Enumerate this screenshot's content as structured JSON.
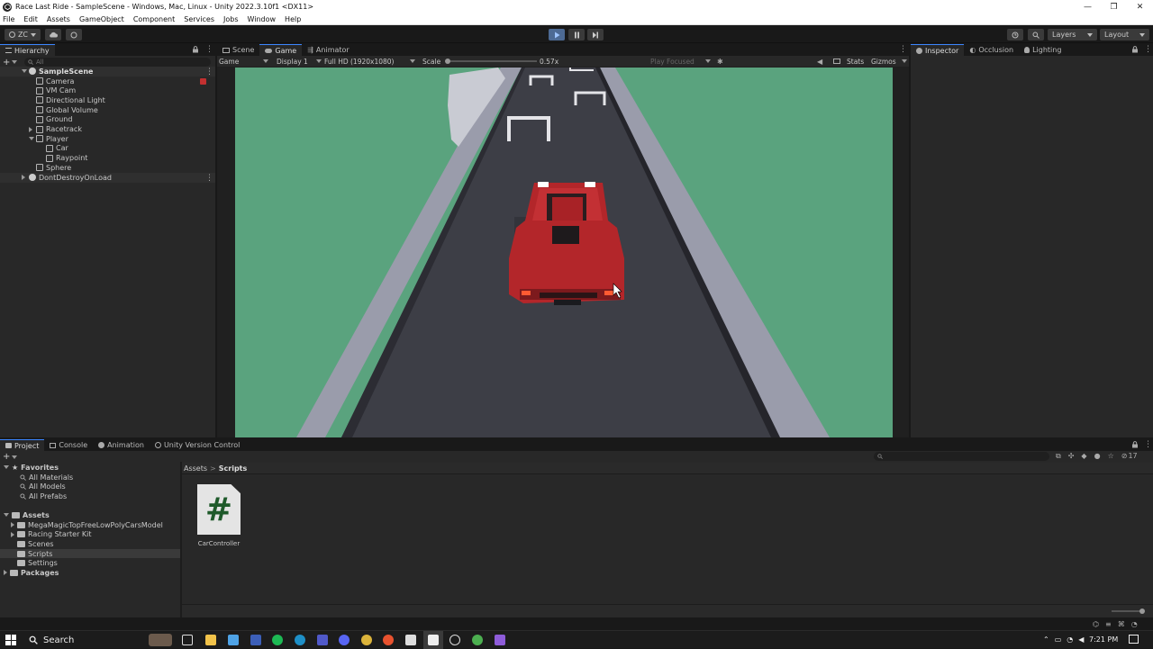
{
  "titlebar": {
    "title": "Race Last Ride - SampleScene - Windows, Mac, Linux - Unity 2022.3.10f1 <DX11>",
    "minimize": "—",
    "restore": "❐",
    "close": "✕"
  },
  "menu": [
    "File",
    "Edit",
    "Assets",
    "GameObject",
    "Component",
    "Services",
    "Jobs",
    "Window",
    "Help"
  ],
  "toolbar": {
    "account": "ZC",
    "layers": "Layers",
    "layout": "Layout"
  },
  "hierarchy": {
    "tab": "Hierarchy",
    "search_placeholder": "All",
    "scene": "SampleScene",
    "items": [
      {
        "label": "Camera",
        "indent": 1
      },
      {
        "label": "VM Cam",
        "indent": 1
      },
      {
        "label": "Directional Light",
        "indent": 1
      },
      {
        "label": "Global Volume",
        "indent": 1
      },
      {
        "label": "Ground",
        "indent": 1
      },
      {
        "label": "Racetrack",
        "indent": 1
      },
      {
        "label": "Player",
        "indent": 1
      },
      {
        "label": "Car",
        "indent": 2
      },
      {
        "label": "Raypoint",
        "indent": 2
      },
      {
        "label": "Sphere",
        "indent": 1
      }
    ],
    "dont_destroy": "DontDestroyOnLoad"
  },
  "center_tabs": [
    "Scene",
    "Game",
    "Animator"
  ],
  "game_toolbar": {
    "view": "Game",
    "display": "Display 1",
    "resolution": "Full HD (1920x1080)",
    "scale_label": "Scale",
    "scale_value": "0.57x",
    "play_focused": "Play Focused",
    "stats": "Stats",
    "gizmos": "Gizmos"
  },
  "right_tabs": [
    "Inspector",
    "Occlusion",
    "Lighting"
  ],
  "bottom_tabs": [
    "Project",
    "Console",
    "Animation",
    "Unity Version Control"
  ],
  "project": {
    "favorites_label": "Favorites",
    "favorites": [
      "All Materials",
      "All Models",
      "All Prefabs"
    ],
    "assets_label": "Assets",
    "assets": [
      "MegaMagicTopFreeLowPolyCarsModel",
      "Racing Starter Kit",
      "Scenes",
      "Scripts",
      "Settings"
    ],
    "packages_label": "Packages",
    "breadcrumb": [
      "Assets",
      "Scripts"
    ],
    "file_name": "CarController",
    "file_glyph": "#",
    "count": "17"
  },
  "taskbar": {
    "search": "Search",
    "time": "7:21 PM"
  },
  "colors": {
    "ground": "#5aa37e",
    "road": "#3d3e46",
    "car": "#b3262a",
    "accent": "#3b86ff"
  }
}
